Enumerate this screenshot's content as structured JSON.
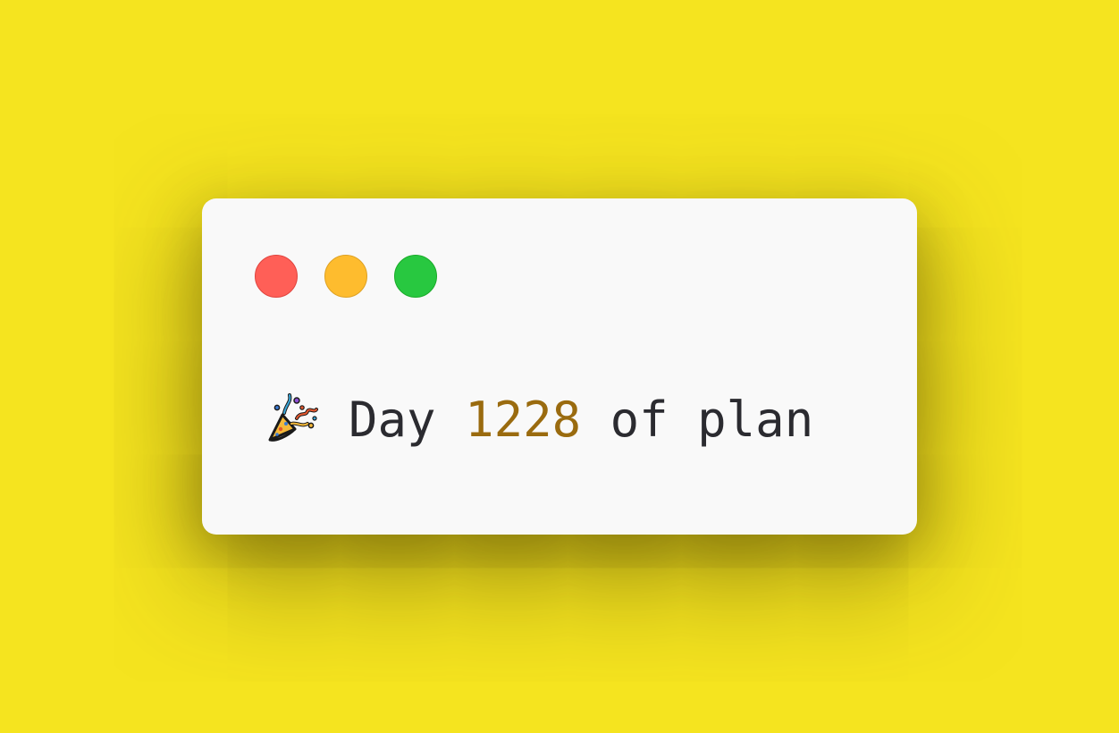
{
  "window": {
    "buttons": {
      "close_color": "#ff5f57",
      "minimize_color": "#febc2e",
      "zoom_color": "#28c840"
    },
    "content": {
      "icon": "party-popper-icon",
      "word_day": "Day",
      "number": "1228",
      "tail": "of plan",
      "number_color": "#9a6b0f",
      "text_color": "#2b2b30"
    }
  },
  "background_color": "#f5e41f"
}
